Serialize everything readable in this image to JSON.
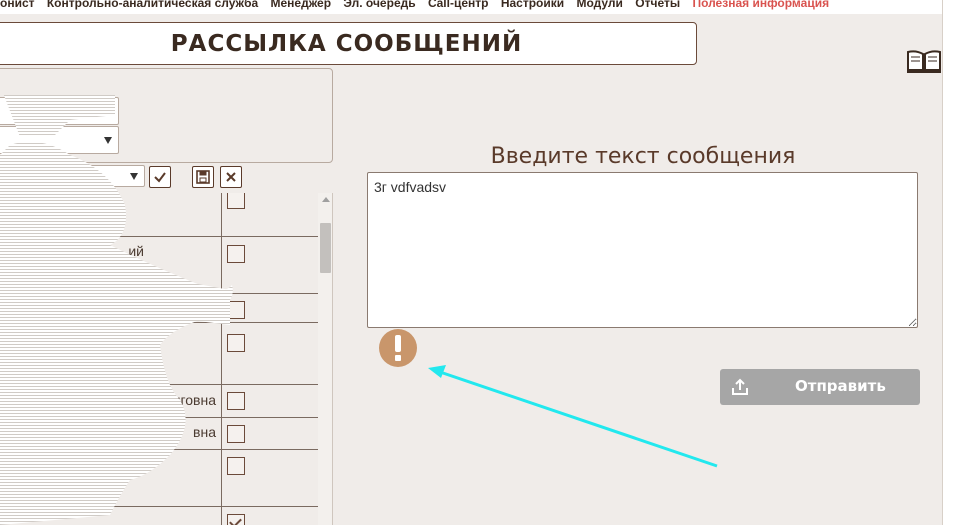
{
  "nav": {
    "items": [
      "онист",
      "Контрольно-аналитическая служба",
      "Менеджер",
      "Эл. очередь",
      "Call-центр",
      "Настройки",
      "Модули",
      "Отчеты",
      "Полезная информация"
    ],
    "accent_color": "#d9534f"
  },
  "page": {
    "title": "РАССЫЛКА СООБЩЕНИЙ",
    "help_icon": "book-icon"
  },
  "filters": {
    "select1_value": "",
    "select2_value": "",
    "select3_value": "",
    "confirm_icon": "check-icon",
    "save_icon": "save-icon",
    "clear_icon": "close-icon"
  },
  "recipients": {
    "rows": [
      {
        "name": "",
        "checked": false
      },
      {
        "name": "ий",
        "checked": false
      },
      {
        "name": "",
        "checked": false
      },
      {
        "name": "",
        "checked": false
      },
      {
        "name": "онговна",
        "checked": false
      },
      {
        "name": "вна",
        "checked": false
      },
      {
        "name": "",
        "checked": false
      },
      {
        "name": "",
        "checked": true
      }
    ]
  },
  "composer": {
    "label": "Введите текст сообщения",
    "message_value": "3г vdfvadsv",
    "warning_icon": "exclamation-icon",
    "warning_color": "#c9966b",
    "send_label": "Отправить",
    "send_icon": "upload-icon",
    "send_color": "#a6a6a6"
  }
}
